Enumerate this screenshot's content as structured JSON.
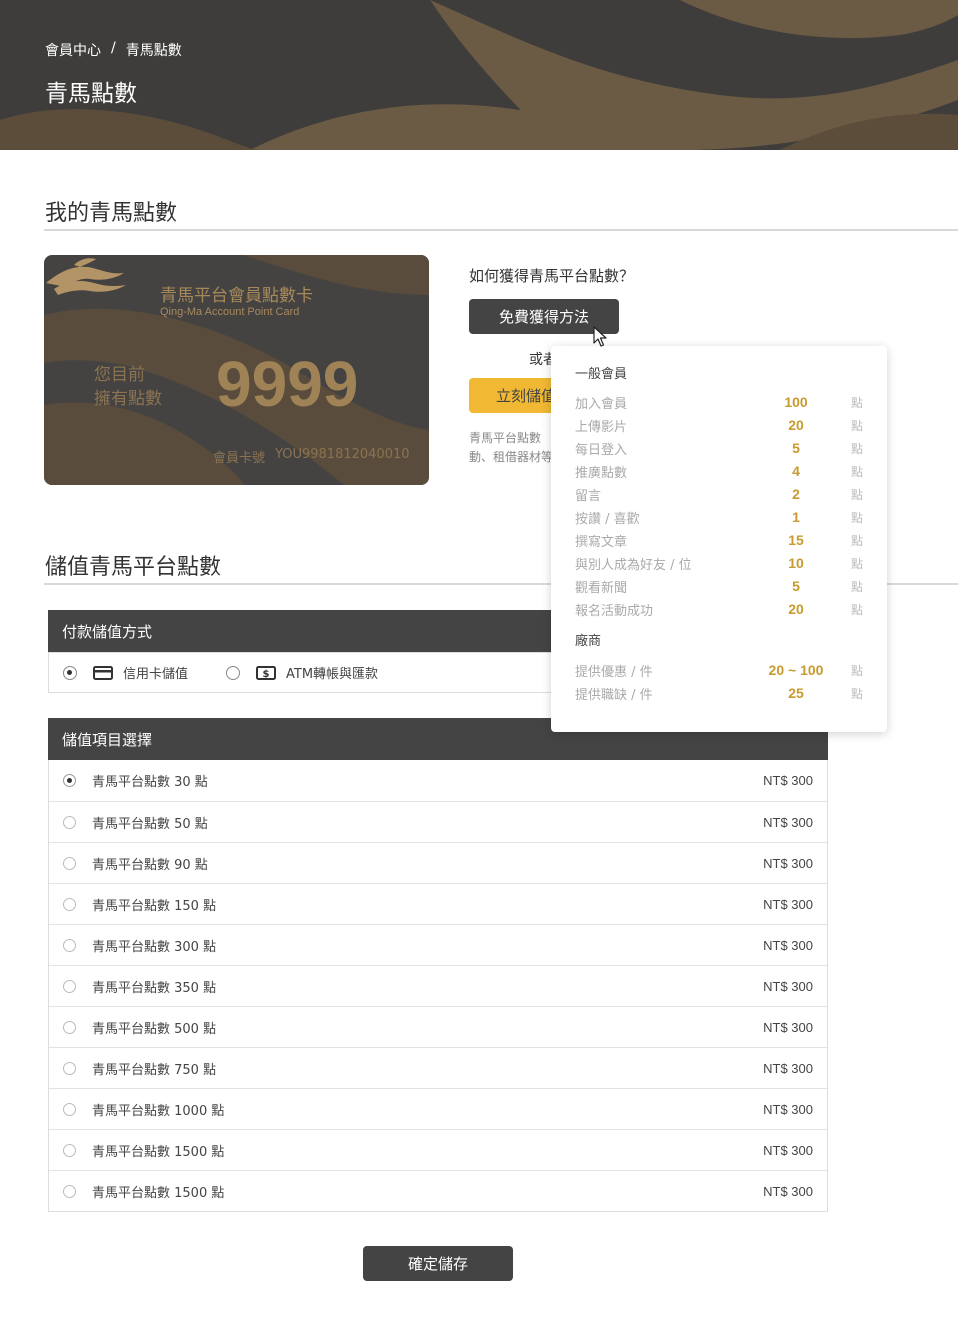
{
  "breadcrumb": {
    "home": "會員中心",
    "separator": "/",
    "current": "青馬點數"
  },
  "page_title": "青馬點數",
  "section_my_points": "我的青馬點數",
  "card": {
    "title": "青馬平台會員點數卡",
    "subtitle": "Qing-Ma Account Point Card",
    "label_line1": "您目前",
    "label_line2": "擁有點數",
    "points": "9999",
    "number_label": "會員卡號",
    "number_value": "YOU9981812040010"
  },
  "info": {
    "how_to": "如何獲得青馬平台點數？",
    "free_button": "免費獲得方法",
    "or_text": "或者",
    "charge_button": "立刻儲值",
    "note_line1": "青馬平台點數",
    "note_line2": "動、租借器材等"
  },
  "popover": {
    "group_member": "一般會員",
    "member_rows": [
      {
        "name": "加入會員",
        "value": "100",
        "unit": "點"
      },
      {
        "name": "上傳影片",
        "value": "20",
        "unit": "點"
      },
      {
        "name": "每日登入",
        "value": "5",
        "unit": "點"
      },
      {
        "name": "推廣點數",
        "value": "4",
        "unit": "點"
      },
      {
        "name": "留言",
        "value": "2",
        "unit": "點"
      },
      {
        "name": "按讚 / 喜歡",
        "value": "1",
        "unit": "點"
      },
      {
        "name": "撰寫文章",
        "value": "15",
        "unit": "點"
      },
      {
        "name": "與別人成為好友 / 位",
        "value": "10",
        "unit": "點"
      },
      {
        "name": "觀看新聞",
        "value": "5",
        "unit": "點"
      },
      {
        "name": "報名活動成功",
        "value": "20",
        "unit": "點"
      }
    ],
    "group_vendor": "廠商",
    "vendor_rows": [
      {
        "name": "提供優惠 / 件",
        "value": "20 ~ 100",
        "unit": "點"
      },
      {
        "name": "提供職缺 / 件",
        "value": "25",
        "unit": "點"
      }
    ]
  },
  "section_topup": "儲值青馬平台點數",
  "payment": {
    "header": "付款儲值方式",
    "options": [
      {
        "label": "信用卡儲值",
        "icon": "credit-card-icon",
        "selected": true
      },
      {
        "label": "ATM轉帳與匯款",
        "icon": "money-icon",
        "selected": false
      }
    ]
  },
  "items": {
    "header": "儲值項目選擇",
    "rows": [
      {
        "label": "青馬平台點數 30 點",
        "price": "NT$ 300",
        "selected": true
      },
      {
        "label": "青馬平台點數 50 點",
        "price": "NT$ 300",
        "selected": false
      },
      {
        "label": "青馬平台點數 90 點",
        "price": "NT$ 300",
        "selected": false
      },
      {
        "label": "青馬平台點數 150 點",
        "price": "NT$ 300",
        "selected": false
      },
      {
        "label": "青馬平台點數 300 點",
        "price": "NT$ 300",
        "selected": false
      },
      {
        "label": "青馬平台點數 350 點",
        "price": "NT$ 300",
        "selected": false
      },
      {
        "label": "青馬平台點數 500 點",
        "price": "NT$ 300",
        "selected": false
      },
      {
        "label": "青馬平台點數 750 點",
        "price": "NT$ 300",
        "selected": false
      },
      {
        "label": "青馬平台點數 1000 點",
        "price": "NT$ 300",
        "selected": false
      },
      {
        "label": "青馬平台點數 1500 點",
        "price": "NT$ 300",
        "selected": false
      },
      {
        "label": "青馬平台點數 1500 點",
        "price": "NT$ 300",
        "selected": false
      }
    ]
  },
  "confirm_button": "確定儲存",
  "colors": {
    "dark": "#444444",
    "gold": "#a08257",
    "accent": "#f0b833",
    "value": "#c99a2e"
  }
}
